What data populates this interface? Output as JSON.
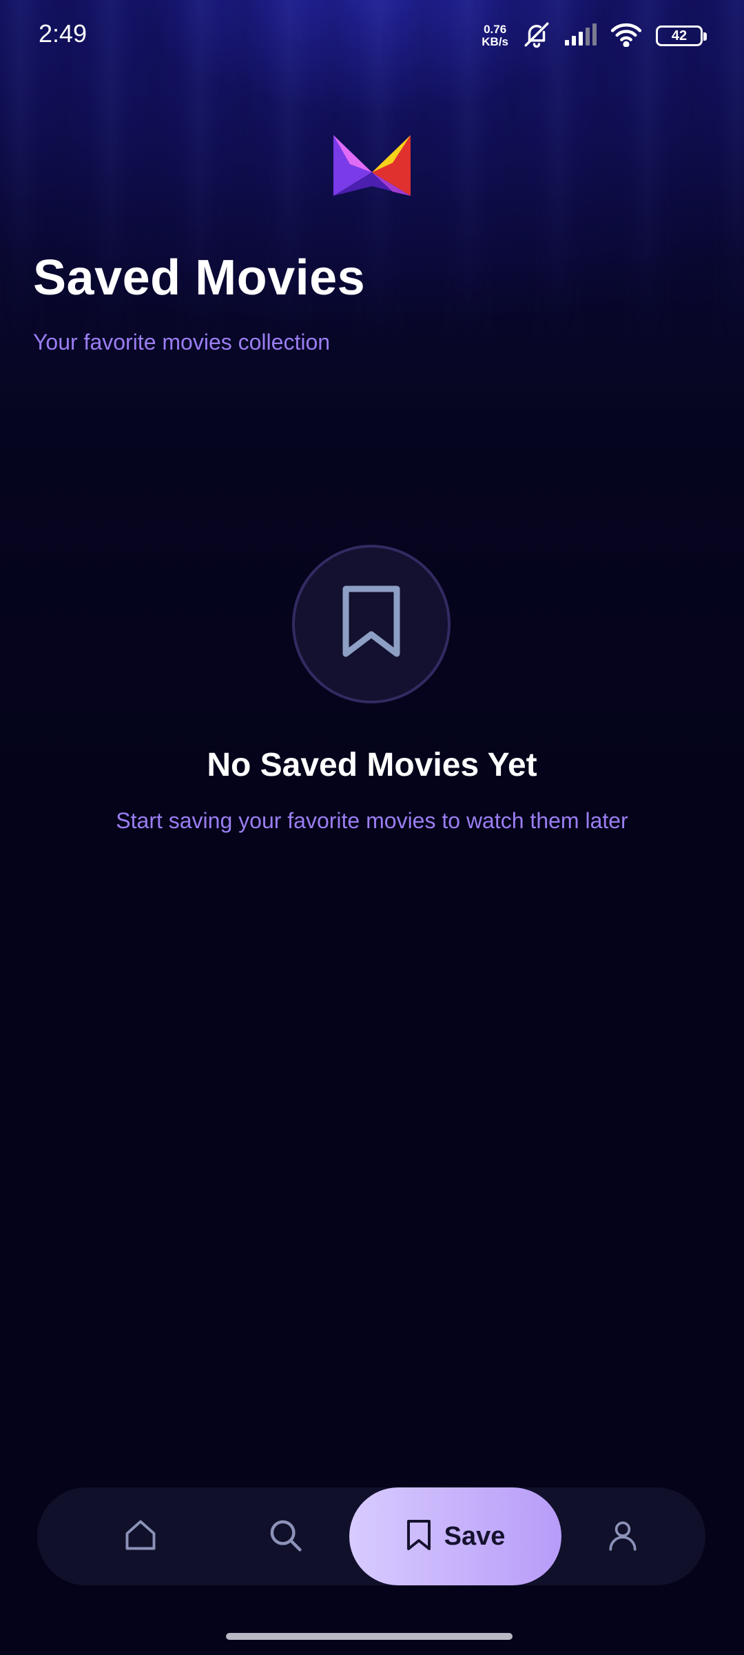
{
  "status_bar": {
    "time": "2:49",
    "net_speed_value": "0.76",
    "net_speed_unit": "KB/s",
    "battery": "42",
    "icons": [
      "mute-icon",
      "signal-icon",
      "wifi-icon",
      "battery-icon"
    ]
  },
  "header": {
    "logo": "app-logo",
    "title": "Saved Movies",
    "subtitle": "Your favorite movies collection"
  },
  "empty_state": {
    "icon": "bookmark-icon",
    "title": "No Saved Movies Yet",
    "description": "Start saving your favorite movies to watch them later"
  },
  "bottom_nav": {
    "items": [
      {
        "icon": "home-icon",
        "label": ""
      },
      {
        "icon": "search-icon",
        "label": ""
      },
      {
        "icon": "bookmark-icon",
        "label": "Save",
        "active": true
      },
      {
        "icon": "profile-icon",
        "label": ""
      }
    ]
  },
  "colors": {
    "background": "#04031a",
    "accent": "#9b7ef2",
    "active_tab_start": "#d8cbff",
    "active_tab_end": "#b79cf8",
    "nav_background": "#10102a"
  }
}
